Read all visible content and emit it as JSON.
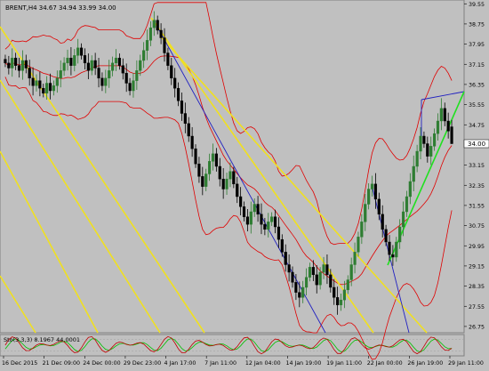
{
  "window": {
    "symbol_header": "BRENT,H4  34.67 34.94 33.99 34.00",
    "osc_header": "Sto(3,3,3) 8.1967 44.0001"
  },
  "colors": {
    "background": "#c0c0c0",
    "bull_candle": "#2e7d32",
    "bear_candle": "#000000",
    "bollinger": "#e00000",
    "trend_yellow": "#f0e020",
    "trend_blue": "#2020c0",
    "trend_green": "#20e020",
    "osc_main": "#c00000",
    "osc_signal": "#00c000"
  },
  "chart_data": [
    {
      "type": "candlestick",
      "symbol": "BRENT",
      "timeframe": "H4",
      "ohlc_last": {
        "open": 34.67,
        "high": 34.94,
        "low": 33.99,
        "close": 34.0
      },
      "current_price_label": "34.00",
      "ylim": [
        26.5,
        39.7
      ],
      "y_ticks": [
        "39.55",
        "38.75",
        "37.95",
        "37.15",
        "36.35",
        "35.55",
        "34.75",
        "33.95",
        "33.15",
        "32.35",
        "31.55",
        "30.75",
        "29.95",
        "29.15",
        "28.35",
        "27.55",
        "26.75"
      ],
      "x_ticks": [
        "16 Dec 2015",
        "21 Dec 09:00",
        "24 Dec 00:00",
        "29 Dec 23:00",
        "4 Jan 17:00",
        "7 Jan 11:00",
        "12 Jan 04:00",
        "14 Jan 19:00",
        "19 Jan 11:00",
        "22 Jan 00:00",
        "26 Jan 19:00",
        "29 Jan 11:00"
      ],
      "closes": [
        37.2,
        37.0,
        37.4,
        37.1,
        36.9,
        37.3,
        37.0,
        36.6,
        36.3,
        36.5,
        36.2,
        36.0,
        36.4,
        36.1,
        36.3,
        36.6,
        36.9,
        37.2,
        37.4,
        37.1,
        37.5,
        37.8,
        37.5,
        37.2,
        36.9,
        37.3,
        37.0,
        36.6,
        36.3,
        36.6,
        36.9,
        37.2,
        37.4,
        37.1,
        36.8,
        36.4,
        36.1,
        36.5,
        36.9,
        37.3,
        37.7,
        38.1,
        38.6,
        38.9,
        38.5,
        38.2,
        37.6,
        37.1,
        36.6,
        36.2,
        35.7,
        35.2,
        34.8,
        34.3,
        33.8,
        33.2,
        32.7,
        32.3,
        32.8,
        33.3,
        33.6,
        33.1,
        32.6,
        32.2,
        32.6,
        32.9,
        32.4,
        31.9,
        31.5,
        31.1,
        30.8,
        31.3,
        31.6,
        31.2,
        30.8,
        30.6,
        30.9,
        31.1,
        30.7,
        30.2,
        29.7,
        29.2,
        28.9,
        28.5,
        28.1,
        27.9,
        28.3,
        28.7,
        29.1,
        28.8,
        28.4,
        28.9,
        29.2,
        28.8,
        28.3,
        27.9,
        27.6,
        27.8,
        28.2,
        28.6,
        29.2,
        29.7,
        30.3,
        30.9,
        31.6,
        32.2,
        32.4,
        31.8,
        31.2,
        30.6,
        30.1,
        29.6,
        29.5,
        30.1,
        30.7,
        31.3,
        31.9,
        32.5,
        33.1,
        33.7,
        34.3,
        34.0,
        33.5,
        33.9,
        34.4,
        34.9,
        35.4,
        34.9,
        34.5,
        34.0
      ],
      "bollinger": {
        "middle_hint": "20-period",
        "upper_band_max": 39.6,
        "lower_band_min": 26.75
      },
      "oscillator": {
        "name": "Sto(3,3,3)",
        "main": 8.1967,
        "signal": 44.0001,
        "levels": [
          20,
          80
        ]
      }
    }
  ]
}
